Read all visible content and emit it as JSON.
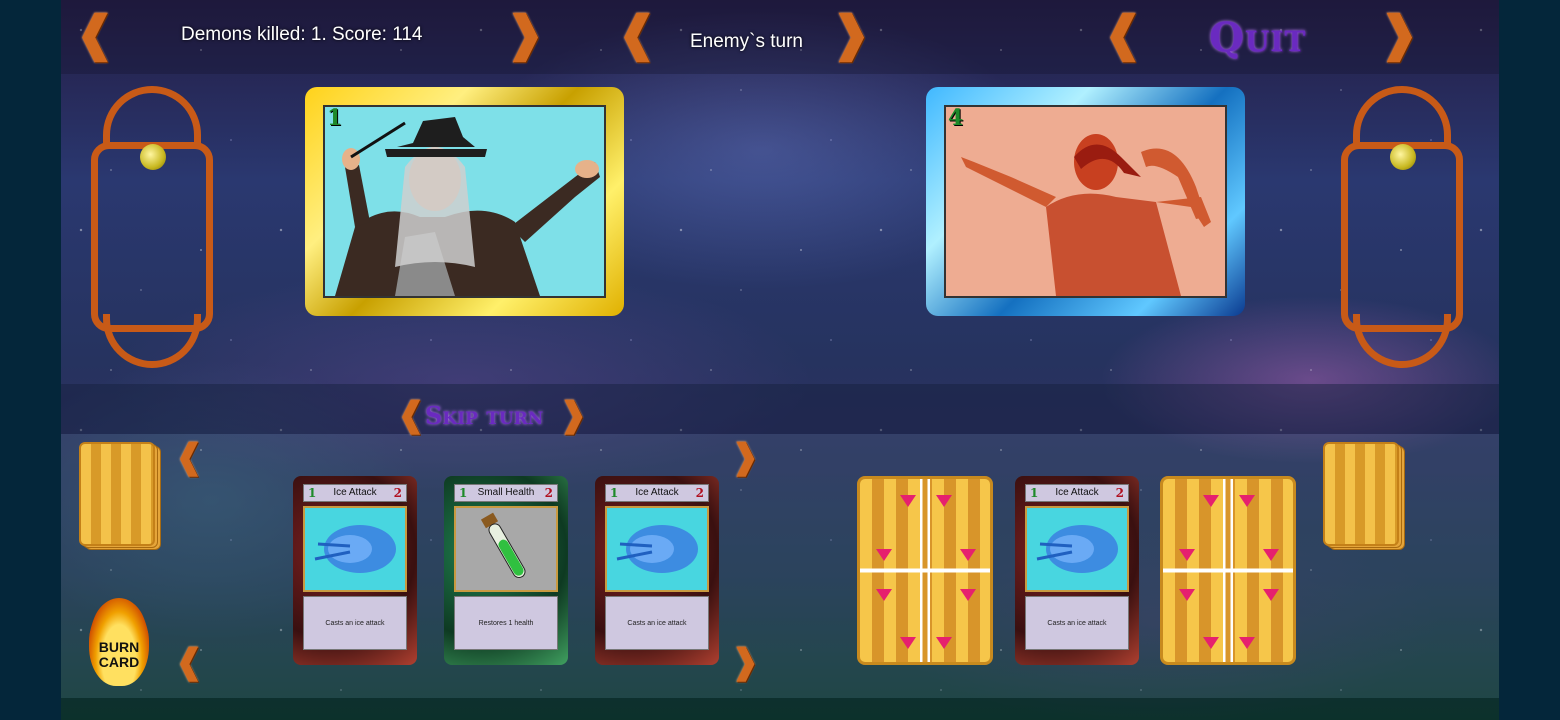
{
  "header": {
    "score_text": "Demons killed: 1. Score: 114",
    "turn_text": "Enemy`s turn",
    "quit_label": "Quit"
  },
  "controls": {
    "skip_label": "Skip turn",
    "burn_label": "BURN CARD"
  },
  "player": {
    "number": "1"
  },
  "enemy": {
    "number": "4"
  },
  "player_hand": [
    {
      "name": "Ice Attack",
      "cost_left": "1",
      "cost_right": "2",
      "desc": "Casts an ice attack",
      "theme": "red"
    },
    {
      "name": "Small Health",
      "cost_left": "1",
      "cost_right": "2",
      "desc": "Restores 1 health",
      "theme": "green"
    },
    {
      "name": "Ice Attack",
      "cost_left": "1",
      "cost_right": "2",
      "desc": "Casts an ice attack",
      "theme": "red"
    }
  ],
  "enemy_hand": [
    {
      "hidden": true
    },
    {
      "name": "Ice Attack",
      "cost_left": "1",
      "cost_right": "2",
      "desc": "Casts an ice attack",
      "theme": "red"
    },
    {
      "hidden": true
    }
  ],
  "colors": {
    "accent_purple": "#6a2ac0",
    "ornament_orange": "#c85a17",
    "cost_green": "#1e8a2a",
    "cost_red": "#b01020"
  }
}
